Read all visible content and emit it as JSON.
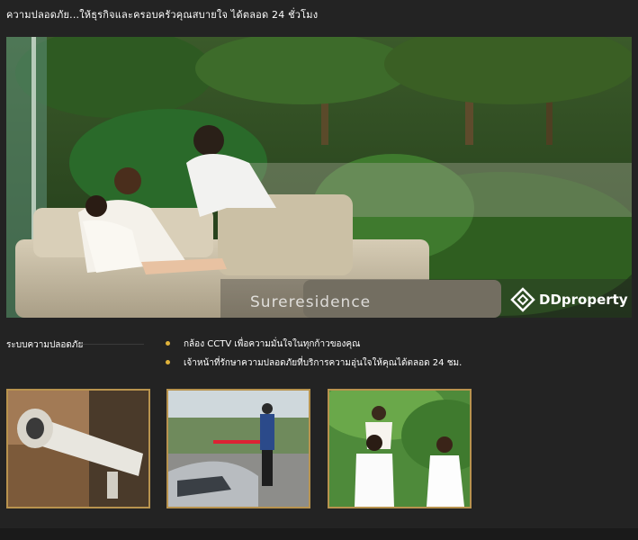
{
  "header": {
    "title": "ความปลอดภัย...ให้ธุรกิจและครอบครัวคุณสบายใจ ได้ตลอด 24 ชั่วโมง"
  },
  "hero": {
    "caption": "Sureresidence",
    "logo_text": "DDproperty",
    "logo_icon": "ddproperty-logo-icon"
  },
  "security": {
    "title": "ระบบความปลอดภัย",
    "features": [
      "กล้อง CCTV เพื่อความมั่นใจในทุกก้าวของคุณ",
      "เจ้าหน้าที่รักษาความปลอดภัยที่บริการความอุ่นใจให้คุณได้ตลอด 24 ชม."
    ]
  },
  "colors": {
    "background": "#232323",
    "bullet": "#e0b23a",
    "frame_gold": "#b8934e"
  }
}
